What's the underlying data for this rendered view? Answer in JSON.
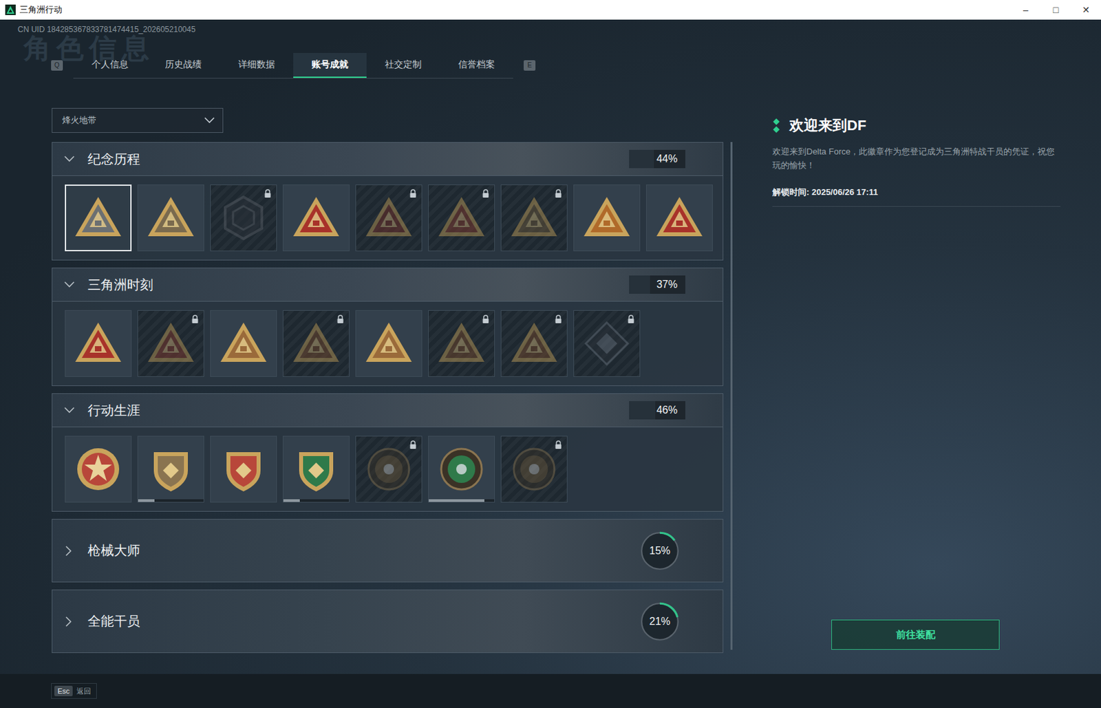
{
  "window": {
    "title": "三角洲行动",
    "controls": [
      "–",
      "□",
      "✕"
    ]
  },
  "uid": "CN UID 184285367833781474415_202605210045",
  "watermark": "角色信息",
  "tabs": {
    "prev_key": "Q",
    "next_key": "E",
    "items": [
      {
        "label": "个人信息",
        "selected": false
      },
      {
        "label": "历史战绩",
        "selected": false
      },
      {
        "label": "详细数据",
        "selected": false
      },
      {
        "label": "账号成就",
        "selected": true
      },
      {
        "label": "社交定制",
        "selected": false
      },
      {
        "label": "信誉档案",
        "selected": false
      }
    ]
  },
  "mode_select": {
    "value": "烽火地带",
    "expanded": false
  },
  "sections": [
    {
      "title": "纪念历程",
      "percent": "44%",
      "level": 0.44,
      "expanded": true,
      "badges": [
        {
          "kind": "triangle",
          "color": "#6b6f72",
          "locked": false,
          "selected": true
        },
        {
          "kind": "triangle",
          "color": "#7a6a4e",
          "locked": false,
          "selected": false
        },
        {
          "kind": "hex",
          "color": "#5a6168",
          "locked": true,
          "selected": false
        },
        {
          "kind": "triangle",
          "color": "#a8322a",
          "locked": false,
          "selected": false
        },
        {
          "kind": "triangle",
          "color": "#7a3028",
          "locked": true,
          "selected": false
        },
        {
          "kind": "triangle",
          "color": "#8a3a2c",
          "locked": true,
          "selected": false
        },
        {
          "kind": "triangle",
          "color": "#6e5a3a",
          "locked": true,
          "selected": false
        },
        {
          "kind": "triangle",
          "color": "#b06a2a",
          "locked": false,
          "selected": false
        },
        {
          "kind": "triangle",
          "color": "#a8322a",
          "locked": false,
          "selected": false
        }
      ]
    },
    {
      "title": "三角洲时刻",
      "percent": "37%",
      "level": 0.37,
      "expanded": true,
      "badges": [
        {
          "kind": "triangle",
          "color": "#a8322a",
          "locked": false,
          "selected": false
        },
        {
          "kind": "triangle",
          "color": "#8a3a2c",
          "locked": true,
          "selected": false
        },
        {
          "kind": "triangle",
          "color": "#9a6a3a",
          "locked": false,
          "selected": false
        },
        {
          "kind": "triangle",
          "color": "#7a4a2a",
          "locked": true,
          "selected": false
        },
        {
          "kind": "triangle",
          "color": "#9a6a3a",
          "locked": false,
          "selected": false
        },
        {
          "kind": "triangle",
          "color": "#7a4a2a",
          "locked": true,
          "selected": false
        },
        {
          "kind": "triangle",
          "color": "#7a4a2a",
          "locked": true,
          "selected": false
        },
        {
          "kind": "diamond",
          "color": "#6a7580",
          "locked": true,
          "selected": false
        }
      ]
    },
    {
      "title": "行动生涯",
      "percent": "46%",
      "level": 0.46,
      "expanded": true,
      "badges": [
        {
          "kind": "medal",
          "color": "#b8473a",
          "locked": false,
          "selected": false
        },
        {
          "kind": "shield",
          "color": "#8a7450",
          "locked": false,
          "selected": false,
          "level": 0.25
        },
        {
          "kind": "shield",
          "color": "#b8473a",
          "locked": false,
          "selected": false
        },
        {
          "kind": "shield",
          "color": "#2f7a4a",
          "locked": false,
          "selected": false,
          "level": 0.25
        },
        {
          "kind": "disc",
          "color": "#6e5a3a",
          "locked": true,
          "selected": false
        },
        {
          "kind": "disc",
          "color": "#2f7a4a",
          "locked": false,
          "selected": false,
          "level": 0.85
        },
        {
          "kind": "disc",
          "color": "#6e5a3a",
          "locked": true,
          "selected": false
        }
      ]
    },
    {
      "title": "枪械大师",
      "percent": "15%",
      "level": 0.15,
      "expanded": false,
      "badges": []
    },
    {
      "title": "全能干员",
      "percent": "21%",
      "level": 0.21,
      "expanded": false,
      "badges": []
    }
  ],
  "detail": {
    "title": "欢迎来到DF",
    "description": "欢迎来到Delta Force，此徽章作为您登记成为三角洲特战干员的凭证，祝您玩的愉快！",
    "unlock": "解锁时间: 2025/06/26 17:11",
    "button": "前往装配"
  },
  "footer": {
    "key": "Esc",
    "label": "返回"
  }
}
